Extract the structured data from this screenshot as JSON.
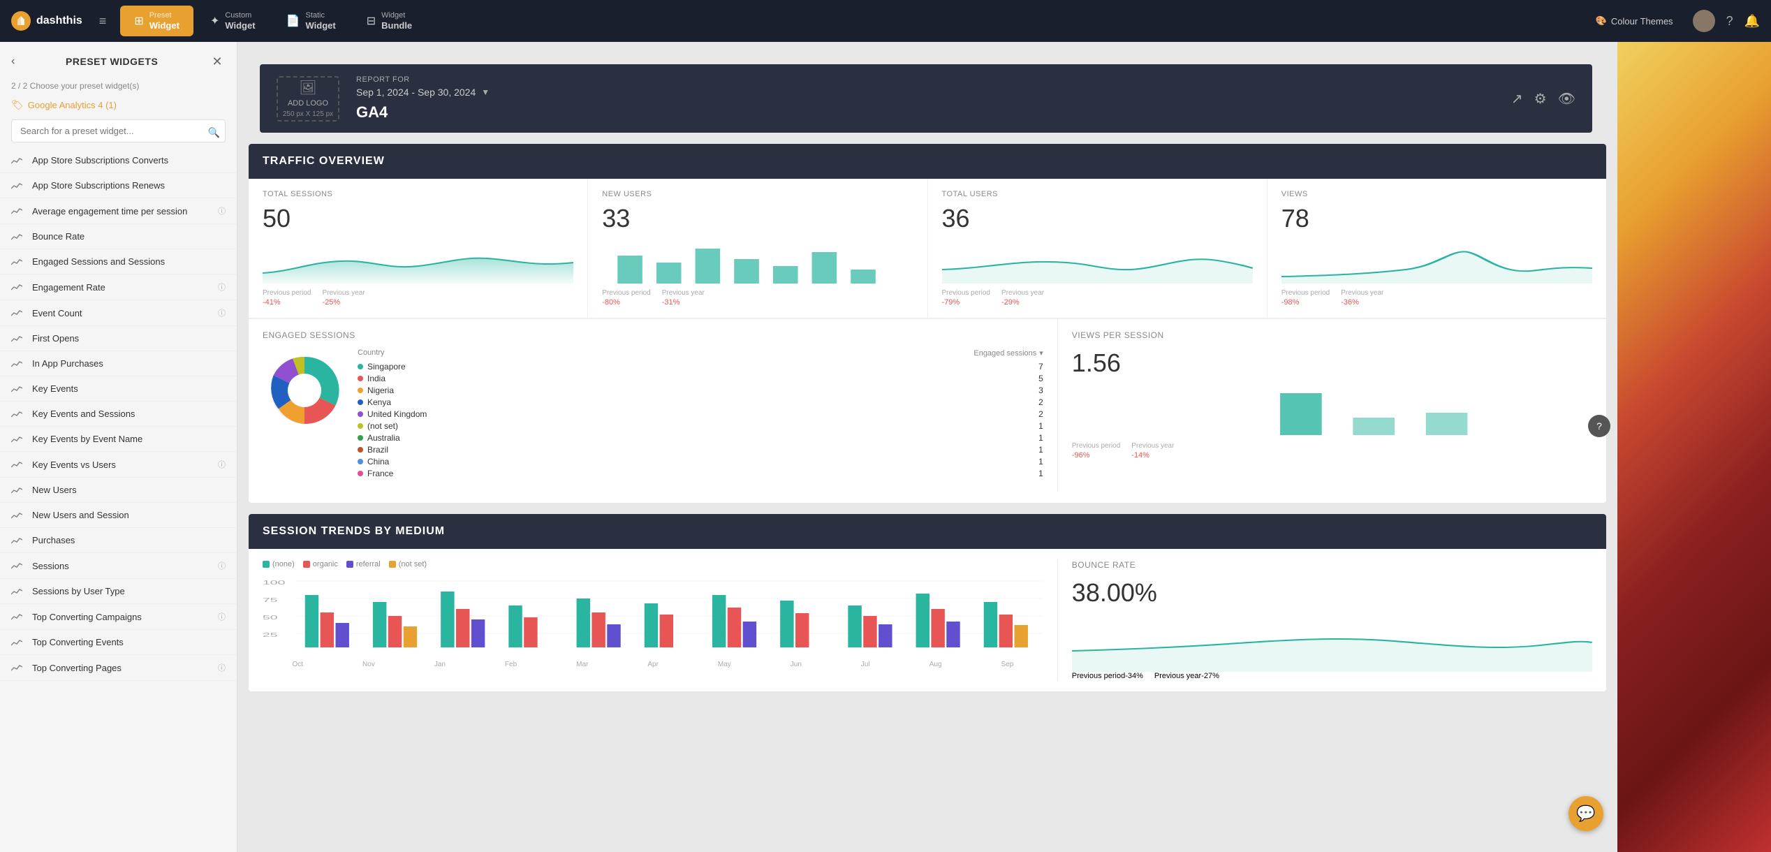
{
  "app": {
    "name": "dashthis",
    "logo_char": "D"
  },
  "nav": {
    "tabs": [
      {
        "id": "preset",
        "top": "Preset",
        "bot": "Widget",
        "active": true,
        "icon": "⊞"
      },
      {
        "id": "custom",
        "top": "Custom",
        "bot": "Widget",
        "active": false,
        "icon": "✦"
      },
      {
        "id": "static",
        "top": "Static",
        "bot": "Widget",
        "active": false,
        "icon": "📄"
      },
      {
        "id": "bundle",
        "top": "Widget",
        "bot": "Bundle",
        "active": false,
        "icon": "⊟"
      }
    ],
    "colour_themes_label": "Colour Themes"
  },
  "sidebar": {
    "title": "PRESET WIDGETS",
    "steps": "2 / 2  Choose your preset widget(s)",
    "ga_label": "Google Analytics 4 (1)",
    "search_placeholder": "Search for a preset widget...",
    "items": [
      {
        "id": "app-store-subs-converts",
        "label": "App Store Subscriptions Converts",
        "has_info": false
      },
      {
        "id": "app-store-subs-renews",
        "label": "App Store Subscriptions Renews",
        "has_info": false
      },
      {
        "id": "avg-engagement-time",
        "label": "Average engagement time per session",
        "has_info": true
      },
      {
        "id": "bounce-rate",
        "label": "Bounce Rate",
        "has_info": false
      },
      {
        "id": "engaged-sessions",
        "label": "Engaged Sessions and Sessions",
        "has_info": false
      },
      {
        "id": "engagement-rate",
        "label": "Engagement Rate",
        "has_info": true
      },
      {
        "id": "event-count",
        "label": "Event Count",
        "has_info": true
      },
      {
        "id": "first-opens",
        "label": "First Opens",
        "has_info": false
      },
      {
        "id": "in-app-purchases",
        "label": "In App Purchases",
        "has_info": false
      },
      {
        "id": "key-events",
        "label": "Key Events",
        "has_info": false
      },
      {
        "id": "key-events-sessions",
        "label": "Key Events and Sessions",
        "has_info": false
      },
      {
        "id": "key-events-event-name",
        "label": "Key Events by Event Name",
        "has_info": false
      },
      {
        "id": "key-events-vs-users",
        "label": "Key Events vs Users",
        "has_info": true
      },
      {
        "id": "new-users",
        "label": "New Users",
        "has_info": false
      },
      {
        "id": "new-users-session",
        "label": "New Users and Session",
        "has_info": false
      },
      {
        "id": "purchases",
        "label": "Purchases",
        "has_info": false
      },
      {
        "id": "sessions",
        "label": "Sessions",
        "has_info": true
      },
      {
        "id": "sessions-user-type",
        "label": "Sessions by User Type",
        "has_info": false
      },
      {
        "id": "top-converting-campaigns",
        "label": "Top Converting Campaigns",
        "has_info": true
      },
      {
        "id": "top-converting-events",
        "label": "Top Converting Events",
        "has_info": false
      },
      {
        "id": "top-converting-pages",
        "label": "Top Converting Pages",
        "has_info": true
      }
    ]
  },
  "report": {
    "logo_placeholder": "ADD LOGO",
    "logo_size": "250 px X 125 px",
    "for_label": "REPORT FOR",
    "dates": "Sep 1, 2024 - Sep 30, 2024",
    "name": "GA4"
  },
  "traffic_overview": {
    "section_title": "TRAFFIC OVERVIEW",
    "metrics": [
      {
        "id": "total-sessions",
        "label": "TOTAL SESSIONS",
        "value": "50",
        "prev_period": "-41%",
        "prev_year": "-25%"
      },
      {
        "id": "new-users",
        "label": "NEW USERS",
        "value": "33",
        "prev_period": "-80%",
        "prev_year": "-31%"
      },
      {
        "id": "total-users",
        "label": "TOTAL USERS",
        "value": "36",
        "prev_period": "-79%",
        "prev_year": "-29%"
      },
      {
        "id": "views",
        "label": "VIEWS",
        "value": "78",
        "prev_period": "-98%",
        "prev_year": "-36%"
      }
    ],
    "prev_period_label": "Previous period",
    "prev_year_label": "Previous year"
  },
  "engaged_sessions": {
    "title": "ENGAGED SESSIONS",
    "country_label": "Country",
    "sessions_label": "Engaged sessions",
    "countries": [
      {
        "name": "Singapore",
        "value": "7",
        "color": "#2ab5a0"
      },
      {
        "name": "India",
        "value": "5",
        "color": "#e85555"
      },
      {
        "name": "Nigeria",
        "value": "3",
        "color": "#f0a030"
      },
      {
        "name": "Kenya",
        "value": "2",
        "color": "#2060c0"
      },
      {
        "name": "United Kingdom",
        "value": "2",
        "color": "#9050d0"
      },
      {
        "name": "(not set)",
        "value": "1",
        "color": "#c0c020"
      },
      {
        "name": "Australia",
        "value": "1",
        "color": "#30a050"
      },
      {
        "name": "Brazil",
        "value": "1",
        "color": "#c05030"
      },
      {
        "name": "China",
        "value": "1",
        "color": "#5090e0"
      },
      {
        "name": "France",
        "value": "1",
        "color": "#e05090"
      }
    ]
  },
  "views_per_session": {
    "title": "VIEWS PER SESSION",
    "value": "1.56",
    "prev_period": "-96%",
    "prev_year": "-14%",
    "prev_period_label": "Previous period",
    "prev_year_label": "Previous year"
  },
  "session_trends": {
    "title": "SESSION TRENDS BY MEDIUM",
    "legend": [
      {
        "label": "(none)",
        "color": "#2ab5a0"
      },
      {
        "label": "organic",
        "color": "#e85555"
      },
      {
        "label": "referral",
        "color": "#6050d0"
      },
      {
        "label": "(not set)",
        "color": "#e8a030"
      }
    ],
    "months": [
      "Oct",
      "Nov",
      "Jan",
      "Feb",
      "Mar",
      "Apr",
      "May",
      "Jun",
      "Jul",
      "Aug",
      "Sep"
    ]
  },
  "bounce_rate": {
    "title": "BOUNCE RATE",
    "value": "38.00%",
    "prev_period": "-34%",
    "prev_year": "-27%",
    "prev_period_label": "Previous period",
    "prev_year_label": "Previous year"
  }
}
